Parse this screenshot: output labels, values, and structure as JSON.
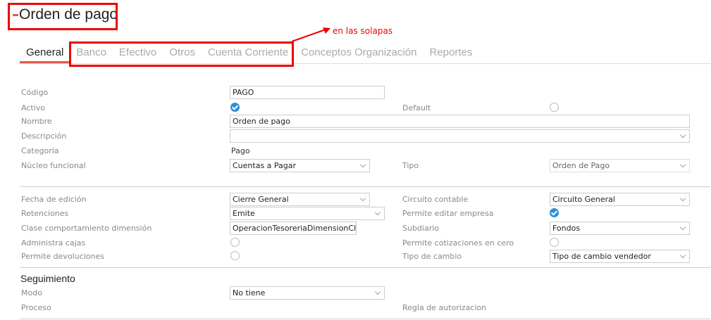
{
  "title": "Orden de pago",
  "annotation": "en las solapas",
  "tabs": [
    "General",
    "Banco",
    "Efectivo",
    "Otros",
    "Cuenta Corriente",
    "Conceptos Organización",
    "Reportes"
  ],
  "form": {
    "codigo": {
      "label": "Código",
      "value": "PAGO"
    },
    "activo": {
      "label": "Activo",
      "checked": true
    },
    "default": {
      "label": "Default",
      "checked": false
    },
    "nombre": {
      "label": "Nombre",
      "value": "Orden de pago"
    },
    "descripcion": {
      "label": "Descripción",
      "value": ""
    },
    "categoria": {
      "label": "Categoría",
      "value": "Pago"
    },
    "nucleo": {
      "label": "Núcleo funcional",
      "value": "Cuentas a Pagar"
    },
    "tipo": {
      "label": "Tipo",
      "value": "Orden de Pago"
    },
    "fecha": {
      "label": "Fecha de edición",
      "value": "Cierre General"
    },
    "circuito": {
      "label": "Circuito contable",
      "value": "Circuito General"
    },
    "retenciones": {
      "label": "Retenciones",
      "value": "Emite"
    },
    "editar_empresa": {
      "label": "Permite editar empresa",
      "checked": true
    },
    "clase": {
      "label": "Clase comportamiento dimensión",
      "value": "OperacionTesoreriaDimensionCl"
    },
    "subdiario": {
      "label": "Subdiario",
      "value": "Fondos"
    },
    "administra": {
      "label": "Administra cajas",
      "checked": false
    },
    "cotiz_cero": {
      "label": "Permite cotizaciones en cero",
      "checked": false
    },
    "devoluciones": {
      "label": "Permite devoluciones",
      "checked": false
    },
    "tipo_cambio": {
      "label": "Tipo de cambio",
      "value": "Tipo de cambio vendedor"
    }
  },
  "seguimiento": {
    "heading": "Seguimiento",
    "modo": {
      "label": "Modo",
      "value": "No tiene"
    },
    "proceso": {
      "label": "Proceso"
    },
    "regla": {
      "label": "Regla de autorizacion"
    }
  }
}
